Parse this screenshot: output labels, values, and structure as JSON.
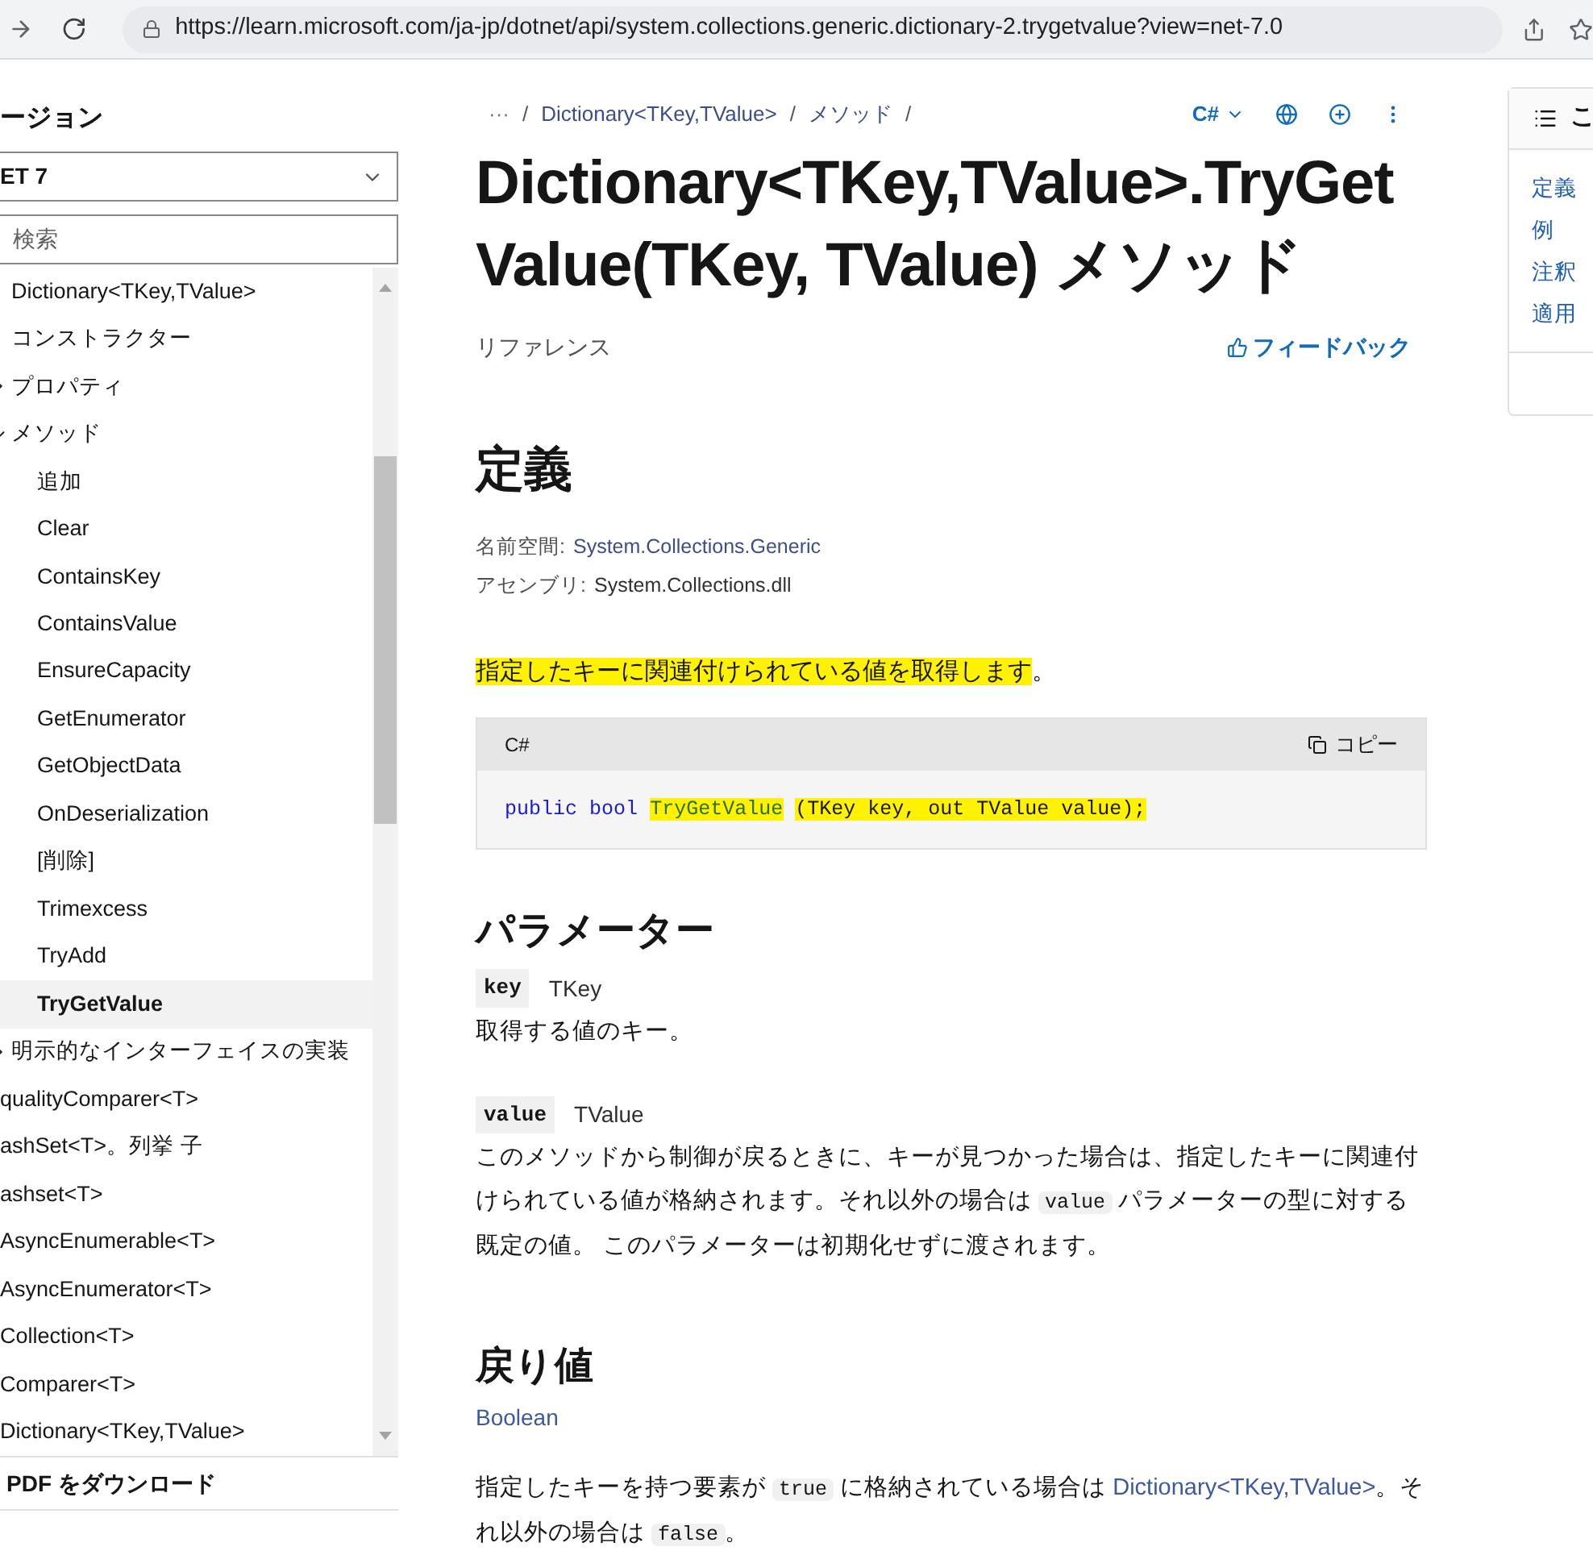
{
  "browser": {
    "url": "https://learn.microsoft.com/ja-jp/dotnet/api/system.collections.generic.dictionary-2.trygetvalue?view=net-7.0"
  },
  "sidebar": {
    "heading": "ージョン",
    "version_select": {
      "value": "ET 7"
    },
    "search": {
      "placeholder": "検索"
    },
    "group_items": [
      {
        "label": "Dictionary<TKey,TValue>",
        "selected": false
      },
      {
        "label": "コンストラクター",
        "selected": false
      },
      {
        "label": "プロパティ",
        "expanded": false,
        "selected": false
      },
      {
        "label": "メソッド",
        "expanded": true,
        "selected": false,
        "children": [
          {
            "label": "追加",
            "selected": false
          },
          {
            "label": "Clear",
            "selected": false
          },
          {
            "label": "ContainsKey",
            "selected": false
          },
          {
            "label": "ContainsValue",
            "selected": false
          },
          {
            "label": "EnsureCapacity",
            "selected": false
          },
          {
            "label": "GetEnumerator",
            "selected": false
          },
          {
            "label": "GetObjectData",
            "selected": false
          },
          {
            "label": "OnDeserialization",
            "selected": false
          },
          {
            "label": "[削除]",
            "selected": false
          },
          {
            "label": "Trimexcess",
            "selected": false
          },
          {
            "label": "TryAdd",
            "selected": false
          },
          {
            "label": "TryGetValue",
            "selected": true
          }
        ]
      },
      {
        "label": "明示的なインターフェイスの実装",
        "expanded": false,
        "selected": false
      }
    ],
    "items": [
      {
        "label": "qualityComparer<T>",
        "selected": false
      },
      {
        "label": "ashSet<T>。列挙 子",
        "selected": false
      },
      {
        "label": "ashset<T>",
        "selected": false
      },
      {
        "label": "AsyncEnumerable<T>",
        "selected": false
      },
      {
        "label": "AsyncEnumerator<T>",
        "selected": false
      },
      {
        "label": "Collection<T>",
        "selected": false
      },
      {
        "label": "Comparer<T>",
        "selected": false
      },
      {
        "label": "Dictionary<TKey,TValue>",
        "selected": false
      }
    ],
    "download": "PDF をダウンロード"
  },
  "breadcrumbs": [
    {
      "text": "···",
      "kind": "more"
    },
    {
      "text": "/",
      "kind": "separator"
    },
    {
      "text": "Dictionary<TKey,TValue>",
      "kind": "link"
    },
    {
      "text": "/",
      "kind": "separator"
    },
    {
      "text": "メソッド",
      "kind": "link"
    },
    {
      "text": "/",
      "kind": "separator"
    }
  ],
  "toolbar": {
    "language": "C#"
  },
  "title": "Dictionary<TKey,TValue>.TryGetValue(TKey, TValue) メソッド",
  "doc_type": "リファレンス",
  "feedback": "フィードバック",
  "definition": {
    "heading": "定義",
    "fields": [
      {
        "label": "名前空間:",
        "value": "System.Collections.Generic"
      },
      {
        "label": "アセンブリ:",
        "value": "System.Collections.dll"
      }
    ]
  },
  "summary": [
    {
      "text": "指定したキーに関連付けられている値を取得します",
      "highlighted": true
    },
    {
      "text": "。",
      "highlighted": false
    }
  ],
  "code": {
    "language": "C#",
    "copy": "コピー",
    "tokens": [
      {
        "text": "public",
        "kind": "keyword",
        "highlighted": false
      },
      {
        "text": "bool",
        "kind": "keyword",
        "highlighted": false
      },
      {
        "text": "TryGetValue",
        "kind": "name",
        "highlighted": true
      },
      {
        "text": "(TKey key, out TValue value);",
        "kind": "plain",
        "highlighted": true
      }
    ]
  },
  "parameters": {
    "heading": "パラメーター",
    "items": [
      {
        "name": "key",
        "type": "TKey",
        "description": [
          {
            "text": "取得する値のキー。",
            "kind": "text"
          }
        ]
      },
      {
        "name": "value",
        "type": "TValue",
        "description": [
          {
            "text": "このメソッドから制御が戻るときに、キーが見つかった場合は、指定したキーに関連付けられている値が格納されます。それ以外の場合は ",
            "kind": "text"
          },
          {
            "text": "value",
            "kind": "code"
          },
          {
            "text": " パラメーターの型に対する既定の値。 このパラメーターは初期化せずに渡されます。",
            "kind": "text"
          }
        ]
      }
    ]
  },
  "returns": {
    "heading": "戻り値",
    "type": "Boolean",
    "description": [
      {
        "text": "指定したキーを持つ要素が ",
        "kind": "text"
      },
      {
        "text": "true",
        "kind": "code"
      },
      {
        "text": " に格納されている場合は ",
        "kind": "text"
      },
      {
        "text": "Dictionary<TKey,TValue>",
        "kind": "link"
      },
      {
        "text": "。それ以外の場合は ",
        "kind": "text"
      },
      {
        "text": "false",
        "kind": "code"
      },
      {
        "text": "。",
        "kind": "text"
      }
    ]
  },
  "toc": {
    "heading": "こ",
    "items": [
      "定義",
      "例",
      "注釈",
      "適用"
    ]
  }
}
